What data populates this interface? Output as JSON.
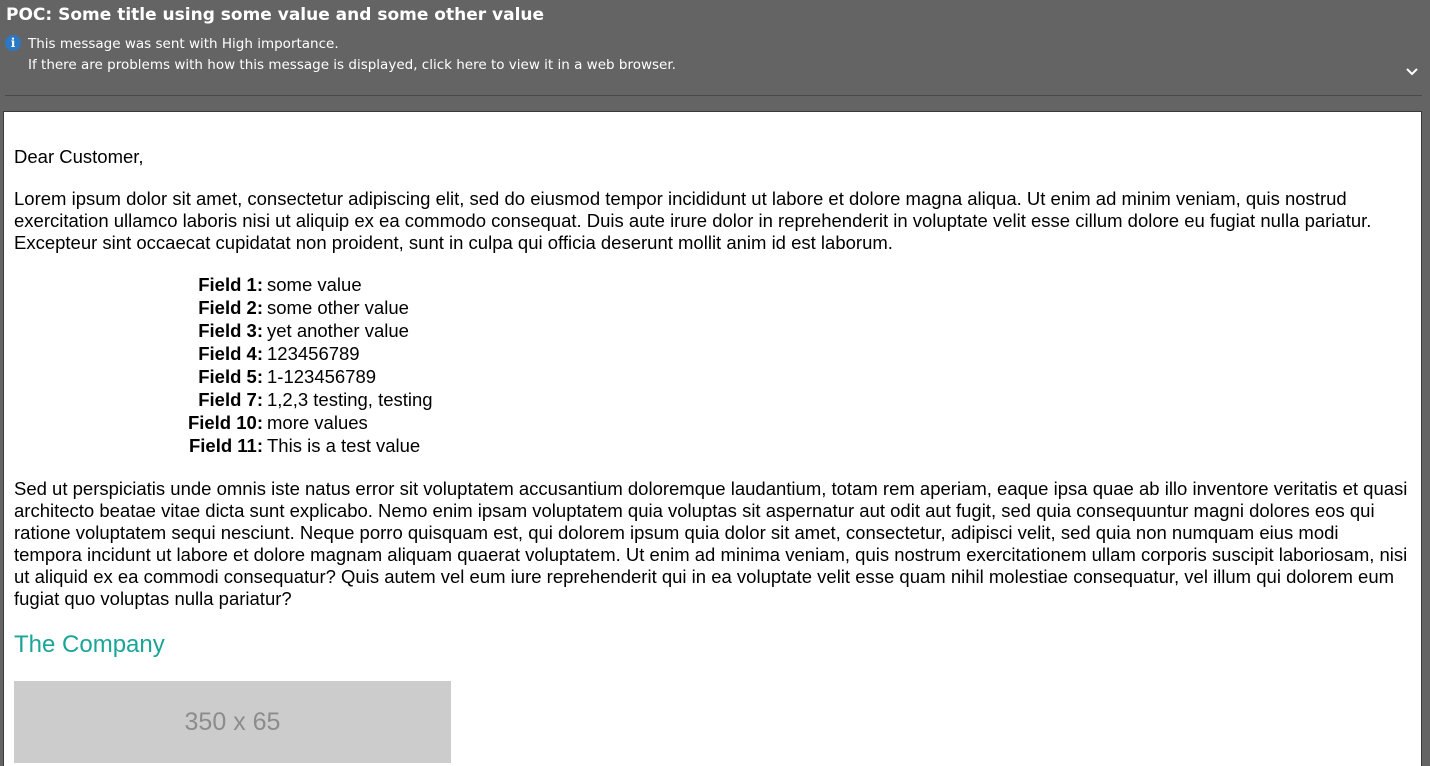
{
  "header": {
    "subject": "POC: Some title using some value and some other value",
    "importance_notice": "This message was sent with High importance.",
    "browser_notice": "If there are problems with how this message is displayed, click here to view it in a web browser.",
    "info_icon": "info-icon",
    "info_icon_glyph": "i",
    "expand_icon": "chevron-down-icon"
  },
  "email": {
    "greeting": "Dear Customer,",
    "intro": "Lorem ipsum dolor sit amet, consectetur adipiscing elit, sed do eiusmod tempor incididunt ut labore et dolore magna aliqua. Ut enim ad minim veniam, quis nostrud exercitation ullamco laboris nisi ut aliquip ex ea commodo consequat. Duis aute irure dolor in reprehenderit in voluptate velit esse cillum dolore eu fugiat nulla pariatur. Excepteur sint occaecat cupidatat non proident, sunt in culpa qui officia deserunt mollit anim id est laborum.",
    "fields": [
      {
        "label": "Field 1:",
        "value": "some value"
      },
      {
        "label": "Field 2:",
        "value": "some other value"
      },
      {
        "label": "Field 3:",
        "value": "yet another value"
      },
      {
        "label": "Field 4:",
        "value": "123456789"
      },
      {
        "label": "Field 5:",
        "value": "1-123456789"
      },
      {
        "label": "Field 7:",
        "value": "1,2,3 testing, testing"
      },
      {
        "label": "Field 10:",
        "value": "more values"
      },
      {
        "label": "Field 11:",
        "value": "This is a test value"
      }
    ],
    "closing": "Sed ut perspiciatis unde omnis iste natus error sit voluptatem accusantium doloremque laudantium, totam rem aperiam, eaque ipsa quae ab illo inventore veritatis et quasi architecto beatae vitae dicta sunt explicabo. Nemo enim ipsam voluptatem quia voluptas sit aspernatur aut odit aut fugit, sed quia consequuntur magni dolores eos qui ratione voluptatem sequi nesciunt. Neque porro quisquam est, qui dolorem ipsum quia dolor sit amet, consectetur, adipisci velit, sed quia non numquam eius modi tempora incidunt ut labore et dolore magnam aliquam quaerat voluptatem. Ut enim ad minima veniam, quis nostrum exercitationem ullam corporis suscipit laboriosam, nisi ut aliquid ex ea commodi consequatur? Quis autem vel eum iure reprehenderit qui in ea voluptate velit esse quam nihil molestiae consequatur, vel illum qui dolorem eum fugiat quo voluptas nulla pariatur?",
    "company_name": "The Company",
    "logo_placeholder_text": "350 x 65"
  },
  "colors": {
    "header_background": "#646464",
    "info_icon": "#2b78c5",
    "company_accent": "#1aa597",
    "placeholder_background": "#cccccc",
    "placeholder_text": "#8c8c8c"
  }
}
